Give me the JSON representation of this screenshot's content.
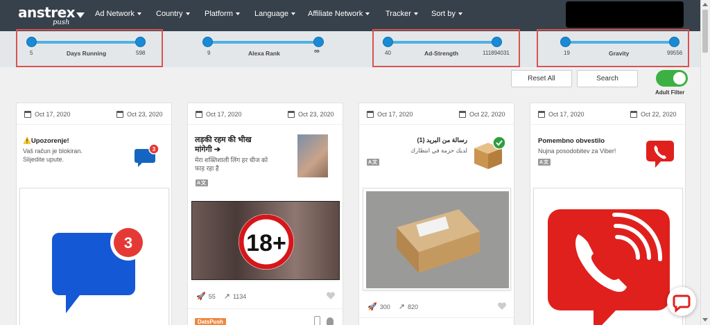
{
  "logo": {
    "main": "anstrex",
    "sub": "push"
  },
  "nav": [
    {
      "label": "Ad Network"
    },
    {
      "label": "Country"
    },
    {
      "label": "Platform"
    },
    {
      "label": "Language"
    },
    {
      "label": "Affiliate Network"
    },
    {
      "label": "Tracker"
    },
    {
      "label": "Sort by"
    }
  ],
  "filters": {
    "days_running": {
      "label": "Days Running",
      "min": "5",
      "max": "598"
    },
    "alexa_rank": {
      "label": "Alexa Rank",
      "min": "9",
      "max": "∞"
    },
    "ad_strength": {
      "label": "Ad-Strength",
      "min": "40",
      "max": "111894031"
    },
    "gravity": {
      "label": "Gravity",
      "min": "19",
      "max": "99556"
    }
  },
  "actions": {
    "reset": "Reset All",
    "search": "Search",
    "adult_filter": "Adult Filter",
    "adult_filter_on": true
  },
  "cards": [
    {
      "start": "Oct 17, 2020",
      "end": "Oct 23, 2020",
      "title": "⚠️Upozorenje!",
      "desc_lines": [
        "Vaš račun je blokiran.",
        "Slijedite upute."
      ],
      "icon_badge": "3",
      "creative_badge": "3"
    },
    {
      "start": "Oct 17, 2020",
      "end": "Oct 23, 2020",
      "title_lines": [
        "लड़की रहम की भीख",
        "मांगेगी ➔"
      ],
      "desc_lines": [
        "मेरा शक्तिशाली लिंग हर चीज को",
        "फाड़ रहा है"
      ],
      "translate": "A文",
      "creative_text": "18+",
      "launches": "55",
      "trend": "1134",
      "network": "DatsPush"
    },
    {
      "start": "Oct 17, 2020",
      "end": "Oct 22, 2020",
      "title": "(1) رسالة من البريد",
      "desc_lines": [
        "لديك حزمة في انتظارك"
      ],
      "translate": "A文",
      "launches": "300",
      "trend": "820"
    },
    {
      "start": "Oct 17, 2020",
      "end": "Oct 22, 2020",
      "title": "Pomembno obvestilo",
      "desc_lines": [
        "Nujna posodobitev za Viber!"
      ],
      "translate": "A文"
    }
  ],
  "colors": {
    "nav_bg": "#37414b",
    "slider": "#1a8ad4",
    "highlight": "#d9534f",
    "toggle": "#3cb043",
    "badge": "#e53935",
    "viber": "#e0201c"
  }
}
